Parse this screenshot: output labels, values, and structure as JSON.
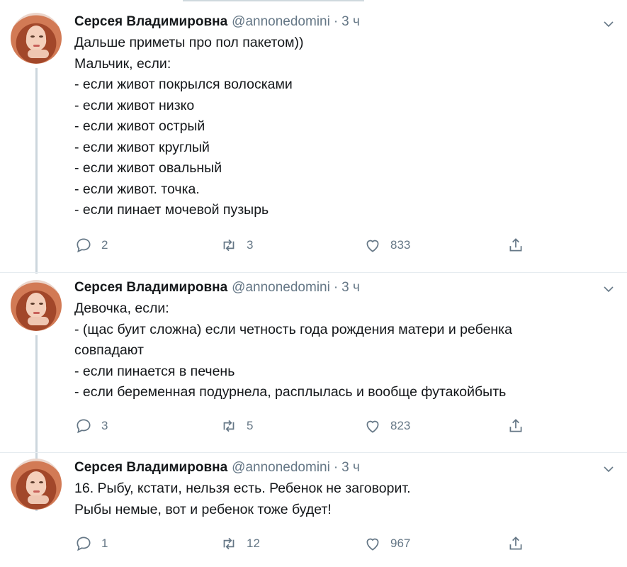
{
  "tweets": [
    {
      "author": "Серсея Владимировна",
      "handle": "@annonedomini",
      "time": "3 ч",
      "lines": [
        "Дальше приметы про пол пакетом))",
        "Мальчик, если:",
        "- если живот покрылся волосками",
        "- если живот низко",
        "- если живот острый",
        "- если живот круглый",
        "- если живот овальный",
        "- если живот. точка.",
        "- если пинает мочевой пузырь"
      ],
      "replies": "2",
      "retweets": "3",
      "likes": "833"
    },
    {
      "author": "Серсея Владимировна",
      "handle": "@annonedomini",
      "time": "3 ч",
      "lines": [
        "Девочка, если:",
        "- (щас буит сложна) если четность года рождения матери и ребенка",
        "совпадают",
        "- если пинается в печень",
        "- если беременная подурнела, расплылась и вообще футакойбыть"
      ],
      "replies": "3",
      "retweets": "5",
      "likes": "823"
    },
    {
      "author": "Серсея Владимировна",
      "handle": "@annonedomini",
      "time": "3 ч",
      "lines": [
        "16. Рыбу, кстати, нельзя есть. Ребенок не заговорит.",
        "Рыбы немые, вот и ребенок тоже будет!"
      ],
      "replies": "1",
      "retweets": "12",
      "likes": "967"
    }
  ],
  "icons": {
    "reply": "reply-icon",
    "retweet": "retweet-icon",
    "like": "heart-icon",
    "share": "share-icon",
    "menu": "chevron-down-icon"
  },
  "colors": {
    "text": "#14171a",
    "muted": "#657786",
    "thread_line": "#ccd6dd",
    "separator": "#e6ecf0"
  }
}
